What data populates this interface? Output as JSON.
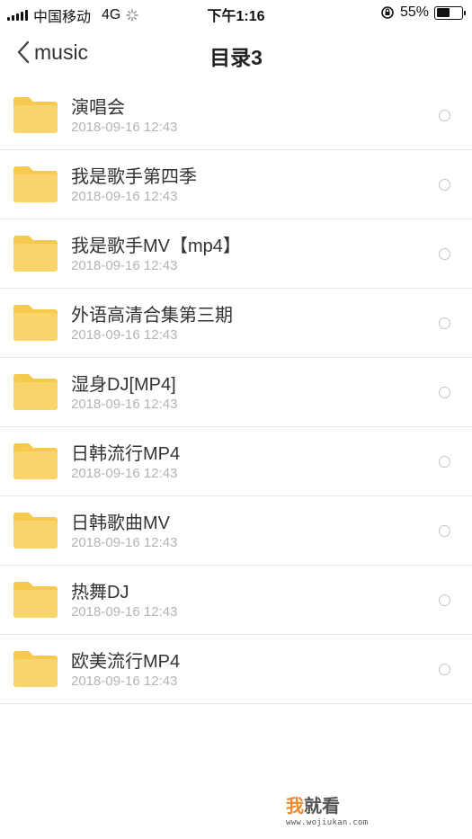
{
  "status_bar": {
    "carrier": "中国移动",
    "network": "4G",
    "time": "下午1:16",
    "battery_percent": "55%",
    "battery_level": 0.55,
    "icons": [
      "signal-icon",
      "activity-spinner-icon",
      "rotation-lock-icon",
      "battery-icon"
    ]
  },
  "nav": {
    "back_label": "music",
    "title": "目录3"
  },
  "colors": {
    "folder": "#f9d46b",
    "folder_tab": "#f6c94f",
    "divider": "#e8e8e8",
    "date_text": "#b4b4b4"
  },
  "folders": [
    {
      "name": "演唱会",
      "date": "2018-09-16 12:43"
    },
    {
      "name": "我是歌手第四季",
      "date": "2018-09-16 12:43"
    },
    {
      "name": "我是歌手MV【mp4】",
      "date": "2018-09-16 12:43"
    },
    {
      "name": "外语高清合集第三期",
      "date": "2018-09-16 12:43"
    },
    {
      "name": "湿身DJ[MP4]",
      "date": "2018-09-16 12:43"
    },
    {
      "name": "日韩流行MP4",
      "date": "2018-09-16 12:43"
    },
    {
      "name": "日韩歌曲MV",
      "date": "2018-09-16 12:43"
    },
    {
      "name": "热舞DJ",
      "date": "2018-09-16 12:43"
    },
    {
      "name": "欧美流行MP4",
      "date": "2018-09-16 12:43"
    }
  ],
  "watermark": {
    "accent_char": "我",
    "rest": "就看",
    "url": "www.wojiukan.com"
  }
}
